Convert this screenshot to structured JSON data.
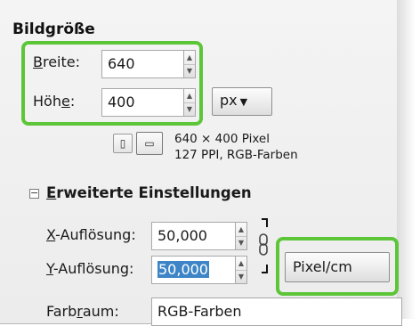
{
  "section_title": "Bildgröße",
  "width": {
    "label_pre": "B",
    "label_rest": "reite:",
    "value": "640"
  },
  "height": {
    "label_pre": "Höh",
    "label_u": "e",
    "label_post": ":",
    "value": "400"
  },
  "unit_button": "px",
  "image_info": {
    "line1": "640 × 400 Pixel",
    "line2": "127 PPI, RGB-Farben"
  },
  "advanced": {
    "label_u": "E",
    "label_rest": "rweiterte Einstellungen",
    "expander": "−"
  },
  "x_resolution": {
    "label_u": "X",
    "label_rest": "-Auflösung:",
    "value": "50,000"
  },
  "y_resolution": {
    "label_u": "Y",
    "label_rest": "-Auflösung:",
    "value": "50,000"
  },
  "resolution_unit_button": "Pixel/cm",
  "colorspace": {
    "label_pre": "Farb",
    "label_u": "r",
    "label_rest": "aum:",
    "value": "RGB-Farben"
  },
  "colors": {
    "highlight": "#5cc638",
    "selection": "#3d85c6"
  }
}
